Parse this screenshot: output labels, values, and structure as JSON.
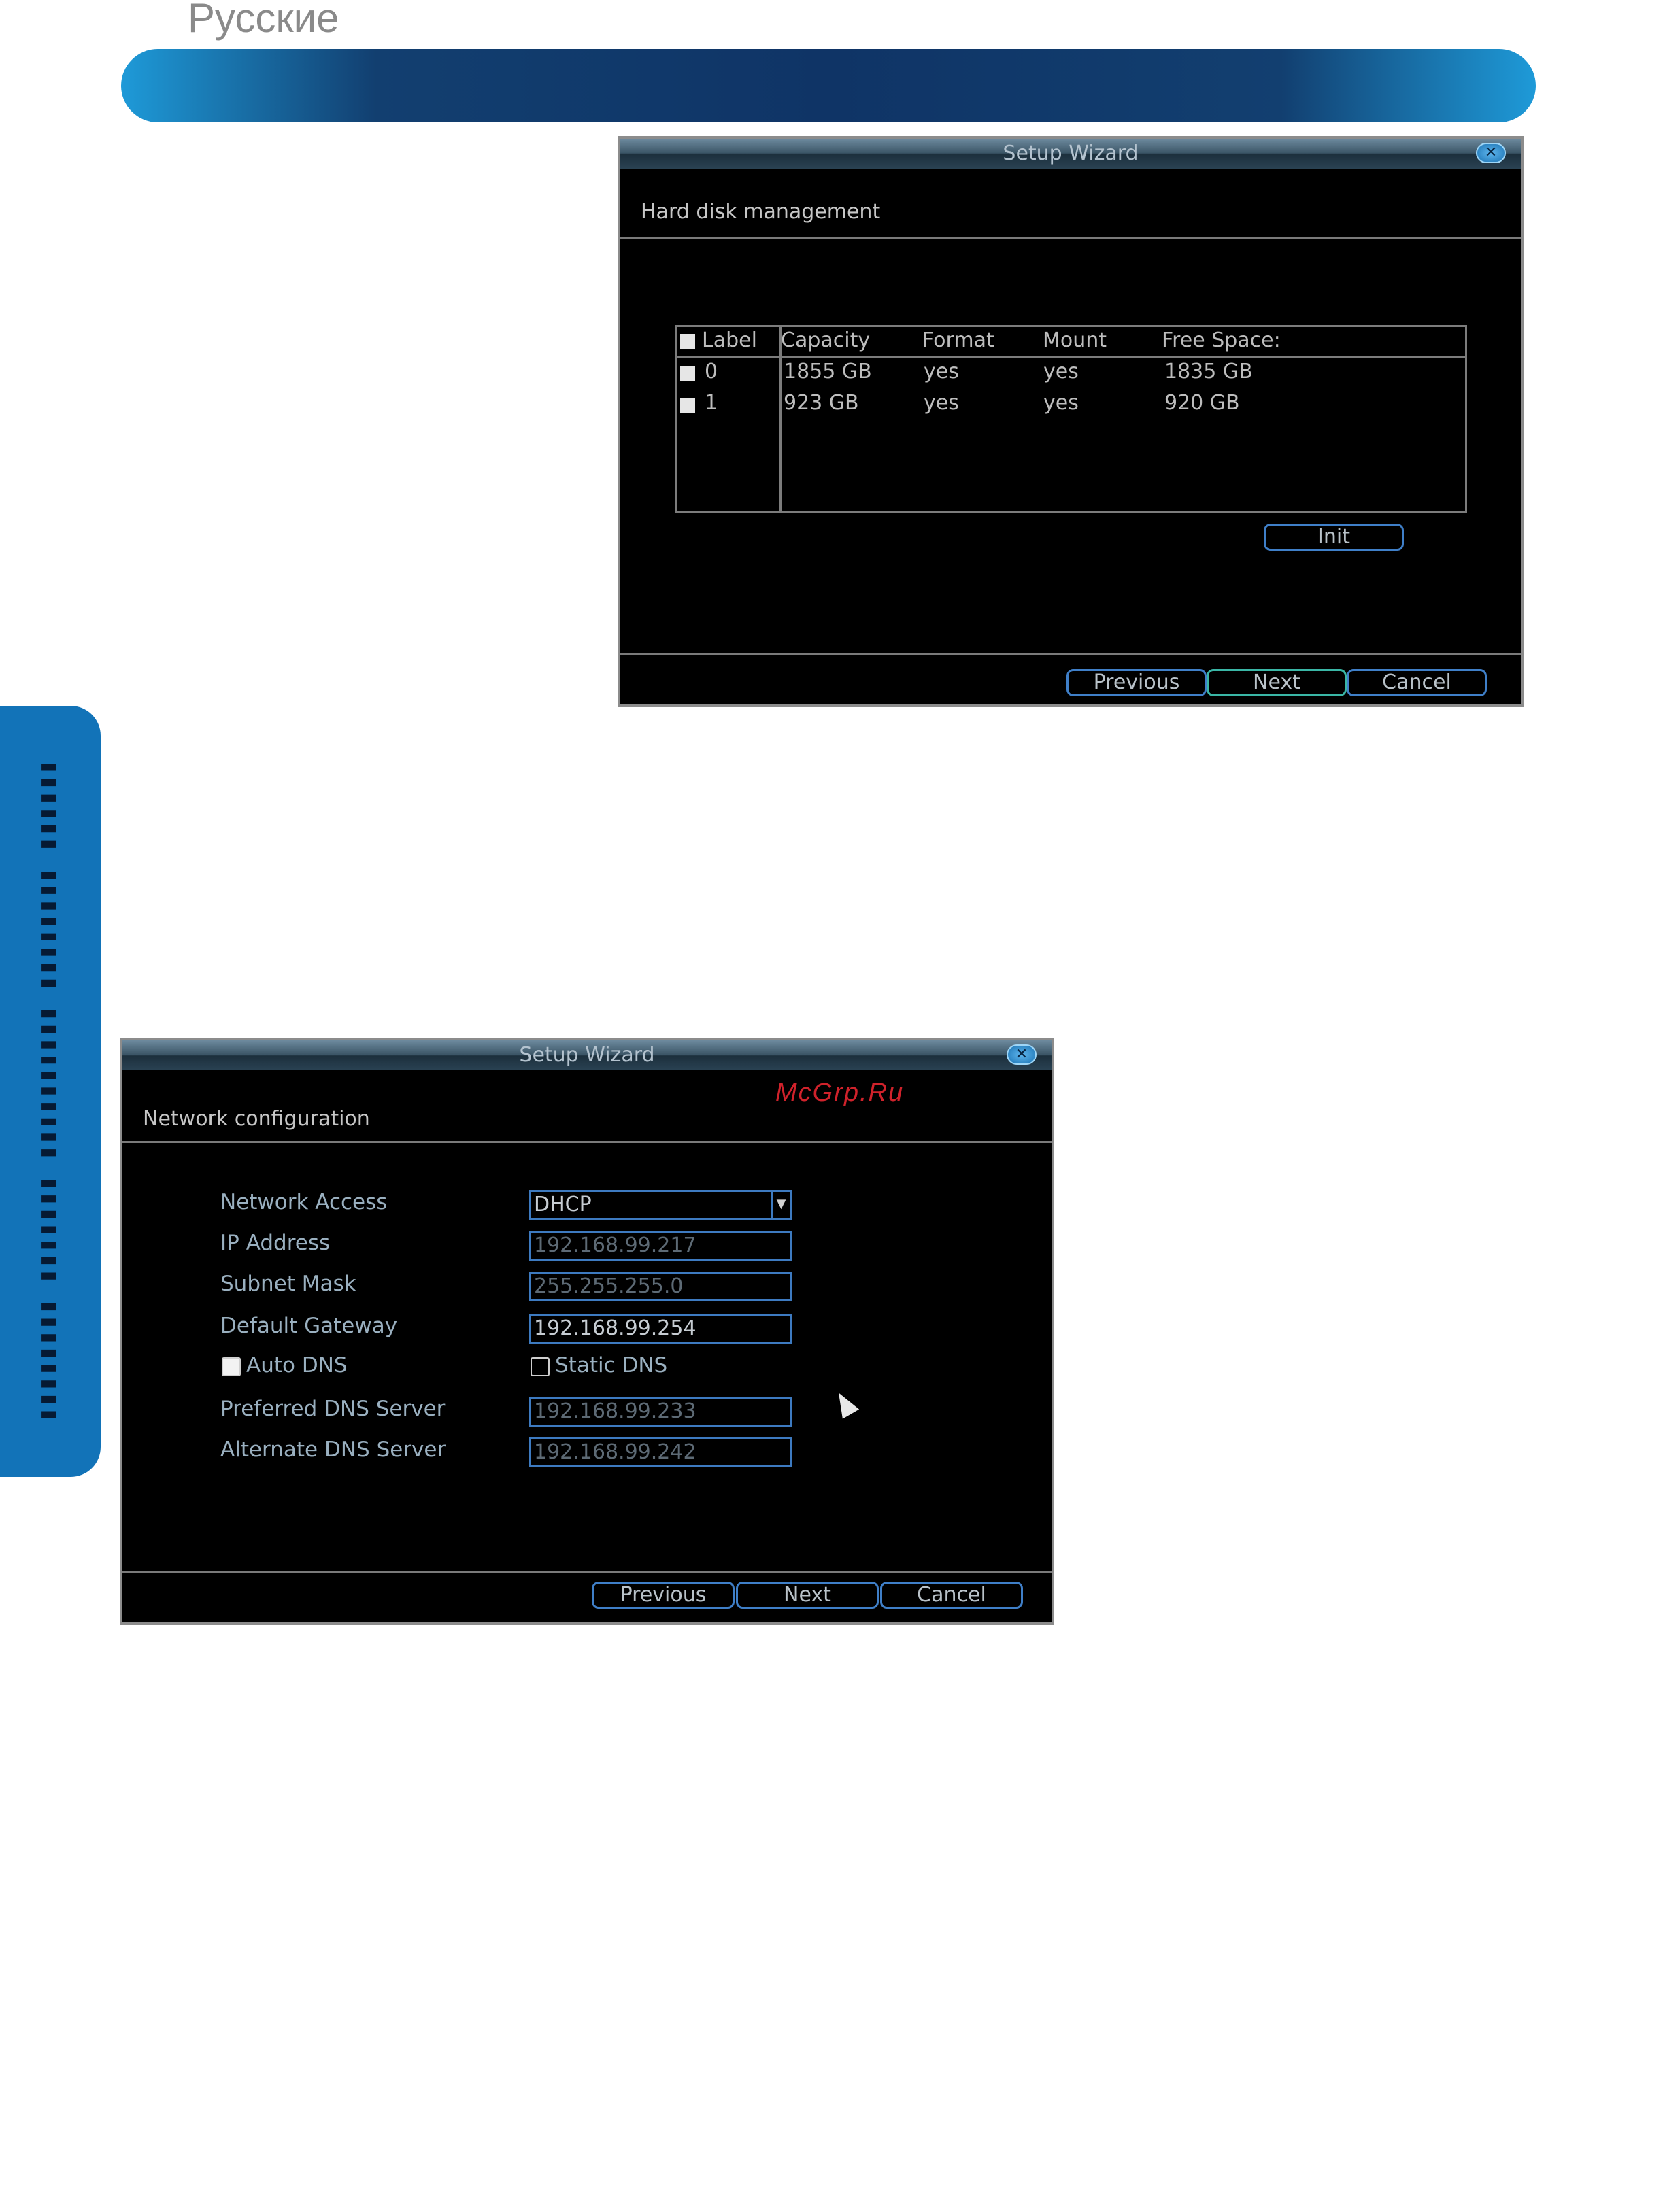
{
  "page": {
    "language": "Русские",
    "side_tab_text": "▮▮▮▮▮▮ ▮▮▮▮▮▮▮▮ ▮▮▮▮▮▮▮▮▮▮ ▮▮▮▮▮▮▮ ▮▮▮▮▮▮▮▮",
    "header_colors": [
      "#1e9ad8",
      "#0f3466"
    ]
  },
  "hdd_dialog": {
    "title": "Setup Wizard",
    "close_icon": "close-x-icon",
    "subtitle": "Hard disk management",
    "table": {
      "headers": [
        "Label",
        "Capacity",
        "Format",
        "Mount",
        "Free Space:"
      ],
      "rows": [
        [
          "0",
          "1855 GB",
          "yes",
          "yes",
          "1835 GB"
        ],
        [
          "1",
          "923 GB",
          "yes",
          "yes",
          "920 GB"
        ]
      ]
    },
    "init_label": "Init",
    "buttons": {
      "previous": "Previous",
      "next": "Next",
      "cancel": "Cancel"
    }
  },
  "network_dialog": {
    "title": "Setup Wizard",
    "close_icon": "close-x-icon",
    "subtitle": "Network configuration",
    "watermark": "McGrp.Ru",
    "fields": {
      "network_access": {
        "label": "Network Access",
        "value": "DHCP"
      },
      "ip_address": {
        "label": "IP Address",
        "value": "192.168.99.217"
      },
      "subnet_mask": {
        "label": "Subnet Mask",
        "value": "255.255.255.0"
      },
      "default_gateway": {
        "label": "Default Gateway",
        "value": "192.168.99.254"
      },
      "auto_dns": {
        "label": "Auto DNS",
        "checked": true
      },
      "static_dns": {
        "label": "Static DNS",
        "checked": false
      },
      "preferred_dns": {
        "label": "Preferred DNS Server",
        "value": "192.168.99.233"
      },
      "alternate_dns": {
        "label": "Alternate DNS Server",
        "value": "192.168.99.242"
      }
    },
    "buttons": {
      "previous": "Previous",
      "next": "Next",
      "cancel": "Cancel"
    }
  }
}
